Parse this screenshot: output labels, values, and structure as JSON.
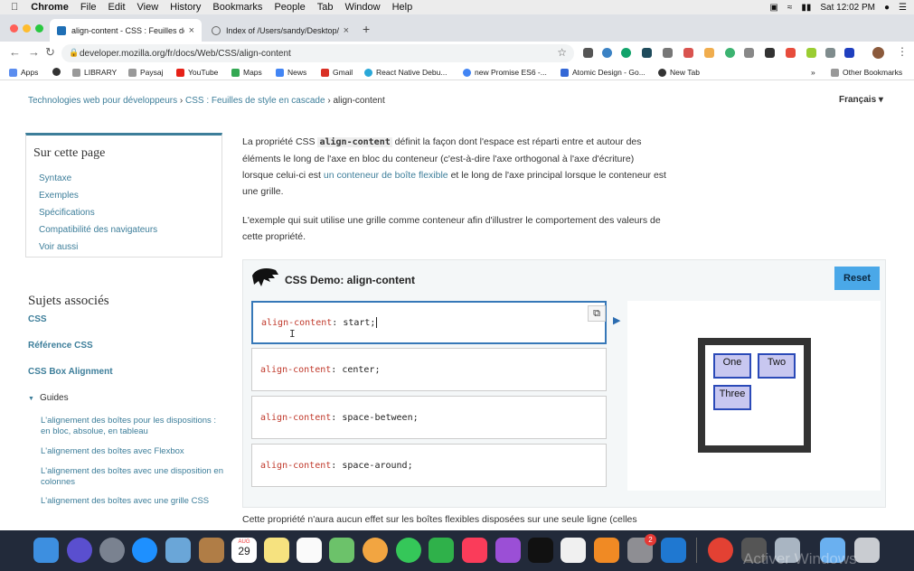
{
  "menubar": {
    "items": [
      "Chrome",
      "File",
      "Edit",
      "View",
      "History",
      "Bookmarks",
      "People",
      "Tab",
      "Window",
      "Help"
    ],
    "clock": "Sat 12:02 PM"
  },
  "tabs": [
    {
      "title": "align-content - CSS : Feuilles de"
    },
    {
      "title": "Index of /Users/sandy/Desktop/j"
    }
  ],
  "address": {
    "url": "developer.mozilla.org/fr/docs/Web/CSS/align-content"
  },
  "bookmarks": {
    "items": [
      "Apps",
      "LIBRARY",
      "Paysaj",
      "YouTube",
      "Maps",
      "News",
      "Gmail",
      "React Native Debu...",
      "new Promise ES6 -...",
      "Atomic Design - Go...",
      "New Tab"
    ],
    "more": "»",
    "other": "Other Bookmarks"
  },
  "breadcrumb": {
    "crumb1": "Technologies web pour développeurs",
    "crumb2": "CSS : Feuilles de style en cascade",
    "current": "align-content",
    "sep": "›"
  },
  "language": "Français ▾",
  "sidebar": {
    "title": "Sur cette page",
    "links": [
      "Syntaxe",
      "Exemples",
      "Spécifications",
      "Compatibilité des navigateurs",
      "Voir aussi"
    ]
  },
  "related": {
    "title": "Sujets associés",
    "links": [
      "CSS",
      "Référence CSS",
      "CSS Box Alignment"
    ],
    "guides_label": "Guides",
    "guides_arrow": "▼",
    "guides": [
      "L'alignement des boîtes pour les dispositions : en bloc, absolue, en tableau",
      "L'alignement des boîtes avec Flexbox",
      "L'alignement des boîtes avec une disposition en colonnes",
      "L'alignement des boîtes avec une grille CSS"
    ]
  },
  "content": {
    "p1_a": "La propriété CSS ",
    "p1_code": "align-content",
    "p1_b": " définit la façon dont l'espace est réparti entre et autour des éléments le long de l'axe en bloc du conteneur (c'est-à-dire l'axe orthogonal à l'axe d'écriture) lorsque celui-ci est ",
    "p1_link": "un conteneur de boîte flexible",
    "p1_c": " et le long de l'axe principal lorsque le conteneur est une grille.",
    "p2": "L'exemple qui suit utilise une grille comme conteneur afin d'illustrer le comportement des valeurs de cette propriété.",
    "p3": "Cette propriété n'aura aucun effet sur les boîtes flexibles disposées sur une seule ligne (celles"
  },
  "demo": {
    "title": "CSS Demo: align-content",
    "reset_label": "Reset",
    "choices": [
      {
        "prop": "align-content",
        "value": "start;"
      },
      {
        "prop": "align-content",
        "value": "center;"
      },
      {
        "prop": "align-content",
        "value": "space-between;"
      },
      {
        "prop": "align-content",
        "value": "space-around;"
      }
    ],
    "selected_index": 0,
    "items": [
      "One",
      "Two",
      "Three"
    ]
  },
  "dock": {
    "calendar_day": "29",
    "calendar_month": "AUG",
    "badge_count": "2"
  },
  "watermark": "Activer Windows"
}
